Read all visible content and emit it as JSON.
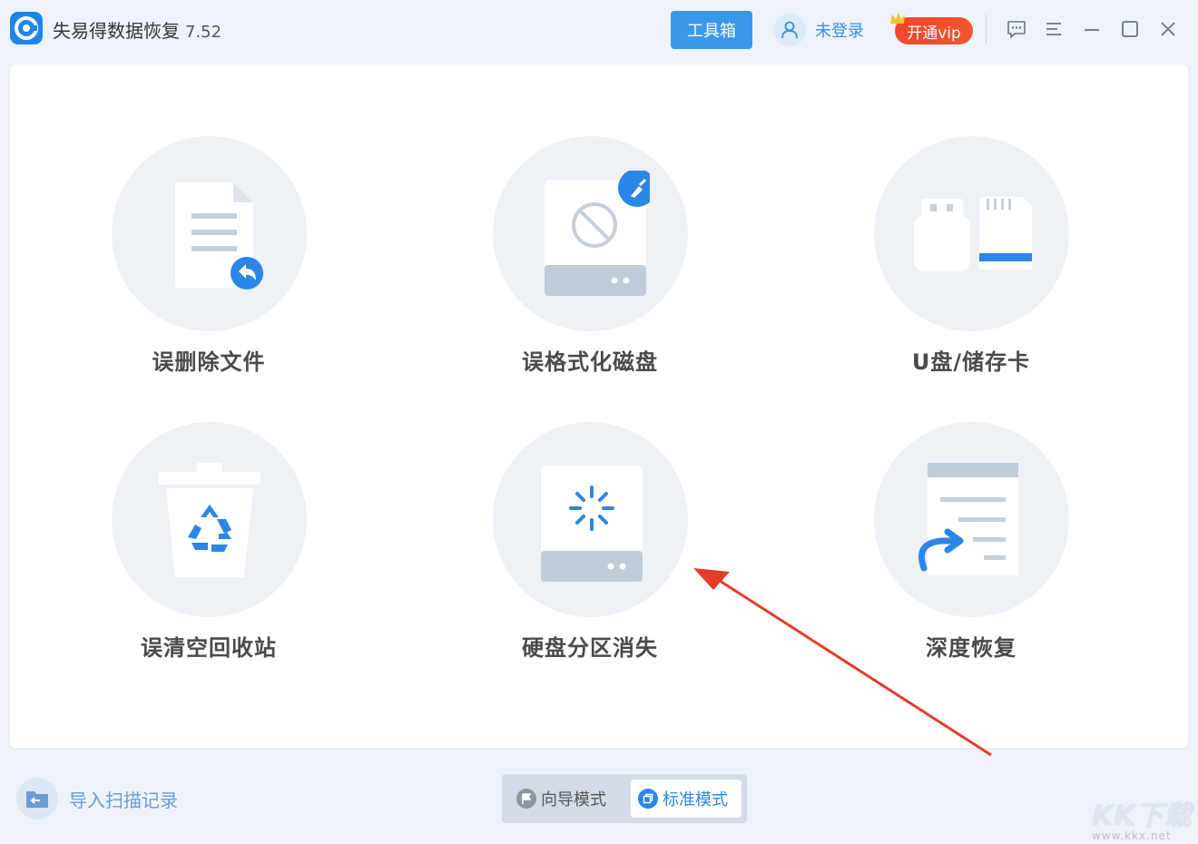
{
  "app": {
    "title": "失易得数据恢复",
    "version": "7.52"
  },
  "header": {
    "toolbox_label": "工具箱",
    "login_label": "未登录",
    "vip_label": "开通vip"
  },
  "cards": [
    {
      "label": "误删除文件",
      "icon": "deleted-file-restore-icon"
    },
    {
      "label": "误格式化磁盘",
      "icon": "formatted-disk-icon"
    },
    {
      "label": "U盘/储存卡",
      "icon": "usb-sdcard-icon"
    },
    {
      "label": "误清空回收站",
      "icon": "recycle-bin-icon"
    },
    {
      "label": "硬盘分区消失",
      "icon": "lost-partition-icon"
    },
    {
      "label": "深度恢复",
      "icon": "deep-recovery-icon"
    }
  ],
  "footer": {
    "import_label": "导入扫描记录",
    "modes": [
      {
        "label": "向导模式"
      },
      {
        "label": "标准模式"
      }
    ]
  },
  "watermark": {
    "text": "KK下载",
    "url": "www.kkx.net"
  },
  "colors": {
    "accent": "#2b86e8",
    "vip": "#f3462b",
    "background": "#eef3f9",
    "annotation_arrow": "#e53c2a"
  }
}
